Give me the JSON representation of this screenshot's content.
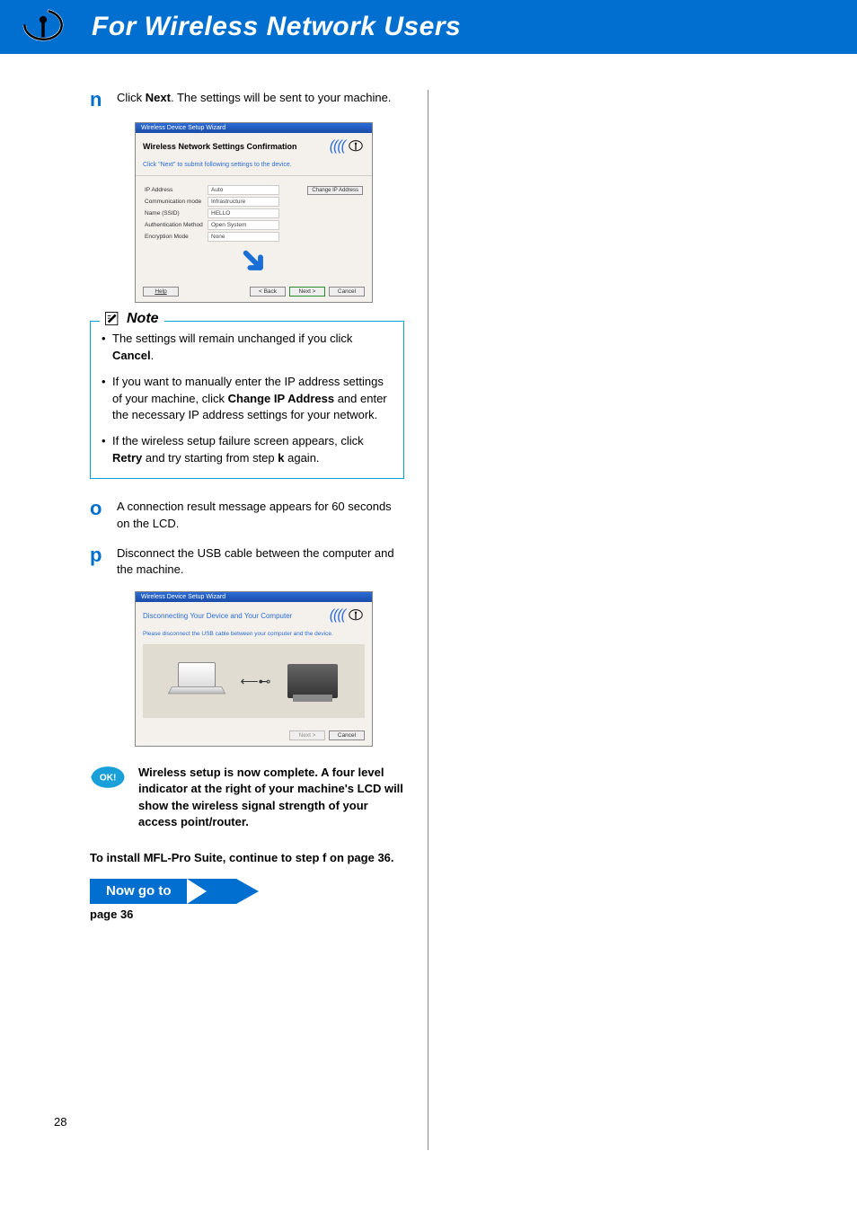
{
  "header": {
    "title": "For Wireless Network Users"
  },
  "steps": {
    "n": {
      "letter": "n",
      "text_pre": "Click ",
      "text_bold": "Next",
      "text_post": ". The settings will be sent to your machine."
    },
    "o": {
      "letter": "o",
      "text": "A connection result message appears for 60 seconds on the LCD."
    },
    "p": {
      "letter": "p",
      "text": "Disconnect the USB cable between the computer and the machine."
    }
  },
  "dialog1": {
    "titlebar": "Wireless Device Setup Wizard",
    "heading": "Wireless Network Settings Confirmation",
    "sub": "Click \"Next\" to submit following settings to the device.",
    "rows": {
      "ip_label": "IP Address",
      "ip_value": "Auto",
      "comm_label": "Communication mode",
      "comm_value": "Infrastructure",
      "ssid_label": "Name (SSID)",
      "ssid_value": "HELLO",
      "auth_label": "Authentication Method",
      "auth_value": "Open System",
      "enc_label": "Encryption Mode",
      "enc_value": "None"
    },
    "change_ip": "Change IP Address",
    "buttons": {
      "help": "Help",
      "back": "< Back",
      "next": "Next >",
      "cancel": "Cancel"
    }
  },
  "note": {
    "title": "Note",
    "item1_pre": "The settings will remain unchanged if you click ",
    "item1_bold": "Cancel",
    "item1_post": ".",
    "item2_pre": "If you want to manually enter the IP address settings of your machine, click ",
    "item2_bold": "Change IP Address",
    "item2_post": " and enter the necessary IP address settings for your network.",
    "item3_pre": "If the wireless setup failure screen appears, click ",
    "item3_bold": "Retry",
    "item3_mid": " and try starting from step ",
    "item3_step": "k",
    "item3_post": " again."
  },
  "dialog2": {
    "titlebar": "Wireless Device Setup Wizard",
    "heading": "Disconnecting Your Device and Your Computer",
    "sub": "Please disconnect the USB cable between your computer and the device.",
    "buttons": {
      "next": "Next >",
      "cancel": "Cancel"
    }
  },
  "ok": {
    "badge": "OK!",
    "text": "Wireless setup is now complete. A four level indicator at the right of your machine's LCD will show the wireless signal strength of your access point/router."
  },
  "continue": {
    "pre": "To install MFL-Pro Suite, continue to step ",
    "step": "f",
    "post": " on page 36."
  },
  "now_go": {
    "label": "Now go to",
    "page": "page 36"
  },
  "page_number": "28"
}
